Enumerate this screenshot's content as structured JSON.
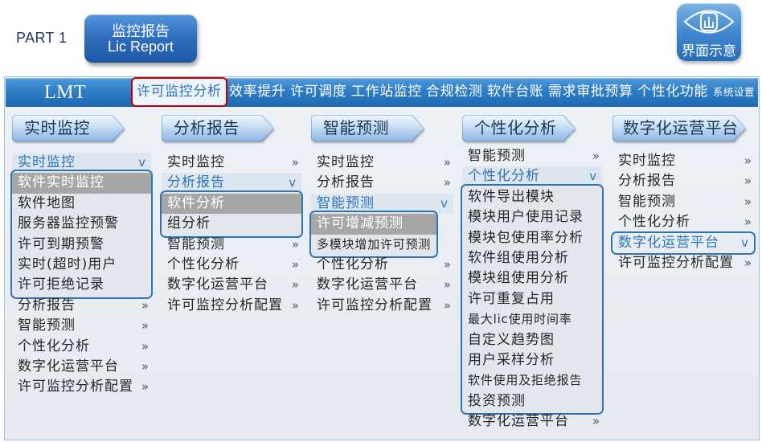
{
  "header": {
    "part_label": "PART 1",
    "report_button": {
      "title": "监控报告",
      "subtitle": "Lic Report"
    },
    "preview_badge": {
      "icon": "eye-chart-icon",
      "label": "界面示意"
    }
  },
  "theme": {
    "primary": "#2e75b6",
    "active_border": "#c00000",
    "selected_bg": "#a6a6a6"
  },
  "navbar": {
    "logo": "LMT",
    "active_index": 0,
    "items": [
      "许可监控分析",
      "效率提升",
      "许可调度",
      "工作站监控",
      "合规检测",
      "软件台账",
      "需求审批预算",
      "个性化功能",
      "系统设置"
    ]
  },
  "columns": [
    {
      "tab": "实时监控",
      "items": [
        {
          "label": "实时监控",
          "icon": "chevron-down-icon",
          "expanded": true,
          "children": [
            {
              "label": "软件实时监控",
              "selected": true
            },
            {
              "label": "软件地图"
            },
            {
              "label": "服务器监控预警"
            },
            {
              "label": "许可到期预警"
            },
            {
              "label": "实时(超时)用户"
            },
            {
              "label": "许可拒绝记录"
            }
          ]
        },
        {
          "label": "分析报告",
          "icon": "double-chevron-right-icon"
        },
        {
          "label": "智能预测",
          "icon": "double-chevron-right-icon"
        },
        {
          "label": "个性化分析",
          "icon": "double-chevron-right-icon"
        },
        {
          "label": "数字化运营平台",
          "icon": "double-chevron-right-icon"
        },
        {
          "label": "许可监控分析配置",
          "icon": "double-chevron-right-icon"
        }
      ]
    },
    {
      "tab": "分析报告",
      "items": [
        {
          "label": "实时监控",
          "icon": "double-chevron-right-icon"
        },
        {
          "label": "分析报告",
          "icon": "chevron-down-icon",
          "expanded": true,
          "children": [
            {
              "label": "软件分析",
              "selected": true
            },
            {
              "label": "组分析"
            }
          ]
        },
        {
          "label": "智能预测",
          "icon": "double-chevron-right-icon"
        },
        {
          "label": "个性化分析",
          "icon": "double-chevron-right-icon"
        },
        {
          "label": "数字化运营平台",
          "icon": "double-chevron-right-icon"
        },
        {
          "label": "许可监控分析配置",
          "icon": "double-chevron-right-icon"
        }
      ]
    },
    {
      "tab": "智能预测",
      "items": [
        {
          "label": "实时监控",
          "icon": "double-chevron-right-icon"
        },
        {
          "label": "分析报告",
          "icon": "double-chevron-right-icon"
        },
        {
          "label": "智能预测",
          "icon": "chevron-down-icon",
          "expanded": true,
          "children": [
            {
              "label": "许可增减预测",
              "selected": true
            },
            {
              "label": "多模块增加许可预测"
            }
          ]
        },
        {
          "label": "个性化分析",
          "icon": "double-chevron-right-icon"
        },
        {
          "label": "数字化运营平台",
          "icon": "double-chevron-right-icon"
        },
        {
          "label": "许可监控分析配置",
          "icon": "double-chevron-right-icon"
        }
      ]
    },
    {
      "tab": "个性化分析",
      "items": [
        {
          "label": "智能预测",
          "icon": "double-chevron-right-icon"
        },
        {
          "label": "个性化分析",
          "icon": "chevron-down-icon",
          "expanded": true,
          "children": [
            {
              "label": "软件导出模块"
            },
            {
              "label": "模块用户使用记录"
            },
            {
              "label": "模块包使用率分析"
            },
            {
              "label": "软件组使用分析"
            },
            {
              "label": "模块组使用分析"
            },
            {
              "label": "许可重复占用"
            },
            {
              "label": "最大lic使用时间率"
            },
            {
              "label": "自定义趋势图"
            },
            {
              "label": "用户采样分析"
            },
            {
              "label": "软件使用及拒绝报告"
            },
            {
              "label": "投资预测"
            }
          ]
        },
        {
          "label": "数字化运营平台",
          "icon": "double-chevron-right-icon"
        }
      ]
    },
    {
      "tab": "数字化运营平台",
      "items": [
        {
          "label": "实时监控",
          "icon": "double-chevron-right-icon"
        },
        {
          "label": "分析报告",
          "icon": "double-chevron-right-icon"
        },
        {
          "label": "智能预测",
          "icon": "double-chevron-right-icon"
        },
        {
          "label": "个性化分析",
          "icon": "double-chevron-right-icon"
        },
        {
          "label": "数字化运营平台",
          "icon": "chevron-down-icon",
          "expanded": true,
          "children": []
        },
        {
          "label": "许可监控分析配置",
          "icon": "double-chevron-right-icon"
        }
      ]
    }
  ]
}
